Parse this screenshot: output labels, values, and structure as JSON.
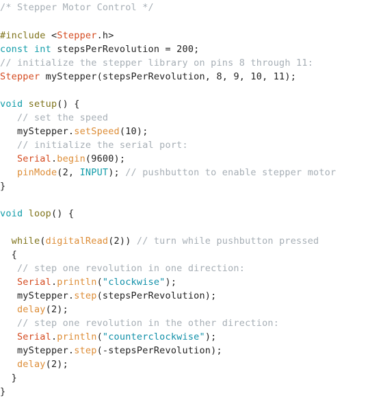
{
  "editor": {
    "app": "arduino-ide-code-view",
    "title": "Stepper Motor Control",
    "language": "arduino-c",
    "font_size_px": 13.5,
    "line_height_px": 20,
    "background": "#ffffff",
    "colors": {
      "plain": "#202020",
      "comment": "#a6aeb5",
      "keyword": "#0f9ba8",
      "function": "#7e7219",
      "type": "#d4491e",
      "method": "#dd8c35",
      "string": "#0f8fa8",
      "preprocessor": "#7e7219"
    }
  },
  "code": {
    "lines": [
      {
        "n": 1,
        "tokens": [
          {
            "t": "/* Stepper Motor Control */",
            "c": "comment"
          }
        ]
      },
      {
        "n": 2,
        "tokens": []
      },
      {
        "n": 3,
        "tokens": [
          {
            "t": "#include",
            "c": "preproc"
          },
          {
            "t": " <",
            "c": "plain"
          },
          {
            "t": "Stepper",
            "c": "type"
          },
          {
            "t": ".h>",
            "c": "plain"
          }
        ]
      },
      {
        "n": 4,
        "tokens": [
          {
            "t": "const",
            "c": "keyword"
          },
          {
            "t": " ",
            "c": "plain"
          },
          {
            "t": "int",
            "c": "keyword"
          },
          {
            "t": " stepsPerRevolution = 200;",
            "c": "plain"
          }
        ]
      },
      {
        "n": 5,
        "tokens": [
          {
            "t": "// initialize the stepper library on pins 8 through 11:",
            "c": "comment"
          }
        ]
      },
      {
        "n": 6,
        "tokens": [
          {
            "t": "Stepper",
            "c": "type"
          },
          {
            "t": " myStepper(stepsPerRevolution, 8, 9, 10, 11);",
            "c": "plain"
          }
        ]
      },
      {
        "n": 7,
        "tokens": []
      },
      {
        "n": 8,
        "tokens": [
          {
            "t": "void",
            "c": "keyword"
          },
          {
            "t": " ",
            "c": "plain"
          },
          {
            "t": "setup",
            "c": "function"
          },
          {
            "t": "() {",
            "c": "plain"
          }
        ]
      },
      {
        "n": 9,
        "tokens": [
          {
            "t": "   ",
            "c": "plain"
          },
          {
            "t": "// set the speed",
            "c": "comment"
          }
        ]
      },
      {
        "n": 10,
        "tokens": [
          {
            "t": "   myStepper.",
            "c": "plain"
          },
          {
            "t": "setSpeed",
            "c": "method"
          },
          {
            "t": "(10);",
            "c": "plain"
          }
        ]
      },
      {
        "n": 11,
        "tokens": [
          {
            "t": "   ",
            "c": "plain"
          },
          {
            "t": "// initialize the serial port:",
            "c": "comment"
          }
        ]
      },
      {
        "n": 12,
        "tokens": [
          {
            "t": "   ",
            "c": "plain"
          },
          {
            "t": "Serial",
            "c": "type"
          },
          {
            "t": ".",
            "c": "plain"
          },
          {
            "t": "begin",
            "c": "method"
          },
          {
            "t": "(9600);",
            "c": "plain"
          }
        ]
      },
      {
        "n": 13,
        "tokens": [
          {
            "t": "   ",
            "c": "plain"
          },
          {
            "t": "pinMode",
            "c": "method"
          },
          {
            "t": "(2, ",
            "c": "plain"
          },
          {
            "t": "INPUT",
            "c": "keyword"
          },
          {
            "t": "); ",
            "c": "plain"
          },
          {
            "t": "// pushbutton to enable stepper motor",
            "c": "comment"
          }
        ]
      },
      {
        "n": 14,
        "tokens": [
          {
            "t": "}",
            "c": "plain"
          }
        ]
      },
      {
        "n": 15,
        "tokens": []
      },
      {
        "n": 16,
        "tokens": [
          {
            "t": "void",
            "c": "keyword"
          },
          {
            "t": " ",
            "c": "plain"
          },
          {
            "t": "loop",
            "c": "function"
          },
          {
            "t": "() {",
            "c": "plain"
          }
        ]
      },
      {
        "n": 17,
        "tokens": []
      },
      {
        "n": 18,
        "tokens": [
          {
            "t": "  ",
            "c": "plain"
          },
          {
            "t": "while",
            "c": "function"
          },
          {
            "t": "(",
            "c": "plain"
          },
          {
            "t": "digitalRead",
            "c": "method"
          },
          {
            "t": "(2)) ",
            "c": "plain"
          },
          {
            "t": "// turn while pushbutton pressed",
            "c": "comment"
          }
        ]
      },
      {
        "n": 19,
        "tokens": [
          {
            "t": "  {",
            "c": "plain"
          }
        ]
      },
      {
        "n": 20,
        "tokens": [
          {
            "t": "   ",
            "c": "plain"
          },
          {
            "t": "// step one revolution in one direction:",
            "c": "comment"
          }
        ]
      },
      {
        "n": 21,
        "tokens": [
          {
            "t": "   ",
            "c": "plain"
          },
          {
            "t": "Serial",
            "c": "type"
          },
          {
            "t": ".",
            "c": "plain"
          },
          {
            "t": "println",
            "c": "method"
          },
          {
            "t": "(",
            "c": "plain"
          },
          {
            "t": "\"clockwise\"",
            "c": "string"
          },
          {
            "t": ");",
            "c": "plain"
          }
        ]
      },
      {
        "n": 22,
        "tokens": [
          {
            "t": "   myStepper.",
            "c": "plain"
          },
          {
            "t": "step",
            "c": "method"
          },
          {
            "t": "(stepsPerRevolution);",
            "c": "plain"
          }
        ]
      },
      {
        "n": 23,
        "tokens": [
          {
            "t": "   ",
            "c": "plain"
          },
          {
            "t": "delay",
            "c": "method"
          },
          {
            "t": "(2);",
            "c": "plain"
          }
        ]
      },
      {
        "n": 24,
        "tokens": [
          {
            "t": "   ",
            "c": "plain"
          },
          {
            "t": "// step one revolution in the other direction:",
            "c": "comment"
          }
        ]
      },
      {
        "n": 25,
        "tokens": [
          {
            "t": "   ",
            "c": "plain"
          },
          {
            "t": "Serial",
            "c": "type"
          },
          {
            "t": ".",
            "c": "plain"
          },
          {
            "t": "println",
            "c": "method"
          },
          {
            "t": "(",
            "c": "plain"
          },
          {
            "t": "\"counterclockwise\"",
            "c": "string"
          },
          {
            "t": ");",
            "c": "plain"
          }
        ]
      },
      {
        "n": 26,
        "tokens": [
          {
            "t": "   myStepper.",
            "c": "plain"
          },
          {
            "t": "step",
            "c": "method"
          },
          {
            "t": "(-stepsPerRevolution);",
            "c": "plain"
          }
        ]
      },
      {
        "n": 27,
        "tokens": [
          {
            "t": "   ",
            "c": "plain"
          },
          {
            "t": "delay",
            "c": "method"
          },
          {
            "t": "(2);",
            "c": "plain"
          }
        ]
      },
      {
        "n": 28,
        "tokens": [
          {
            "t": "  }",
            "c": "plain"
          }
        ]
      },
      {
        "n": 29,
        "tokens": [
          {
            "t": "}",
            "c": "plain"
          }
        ]
      }
    ]
  }
}
